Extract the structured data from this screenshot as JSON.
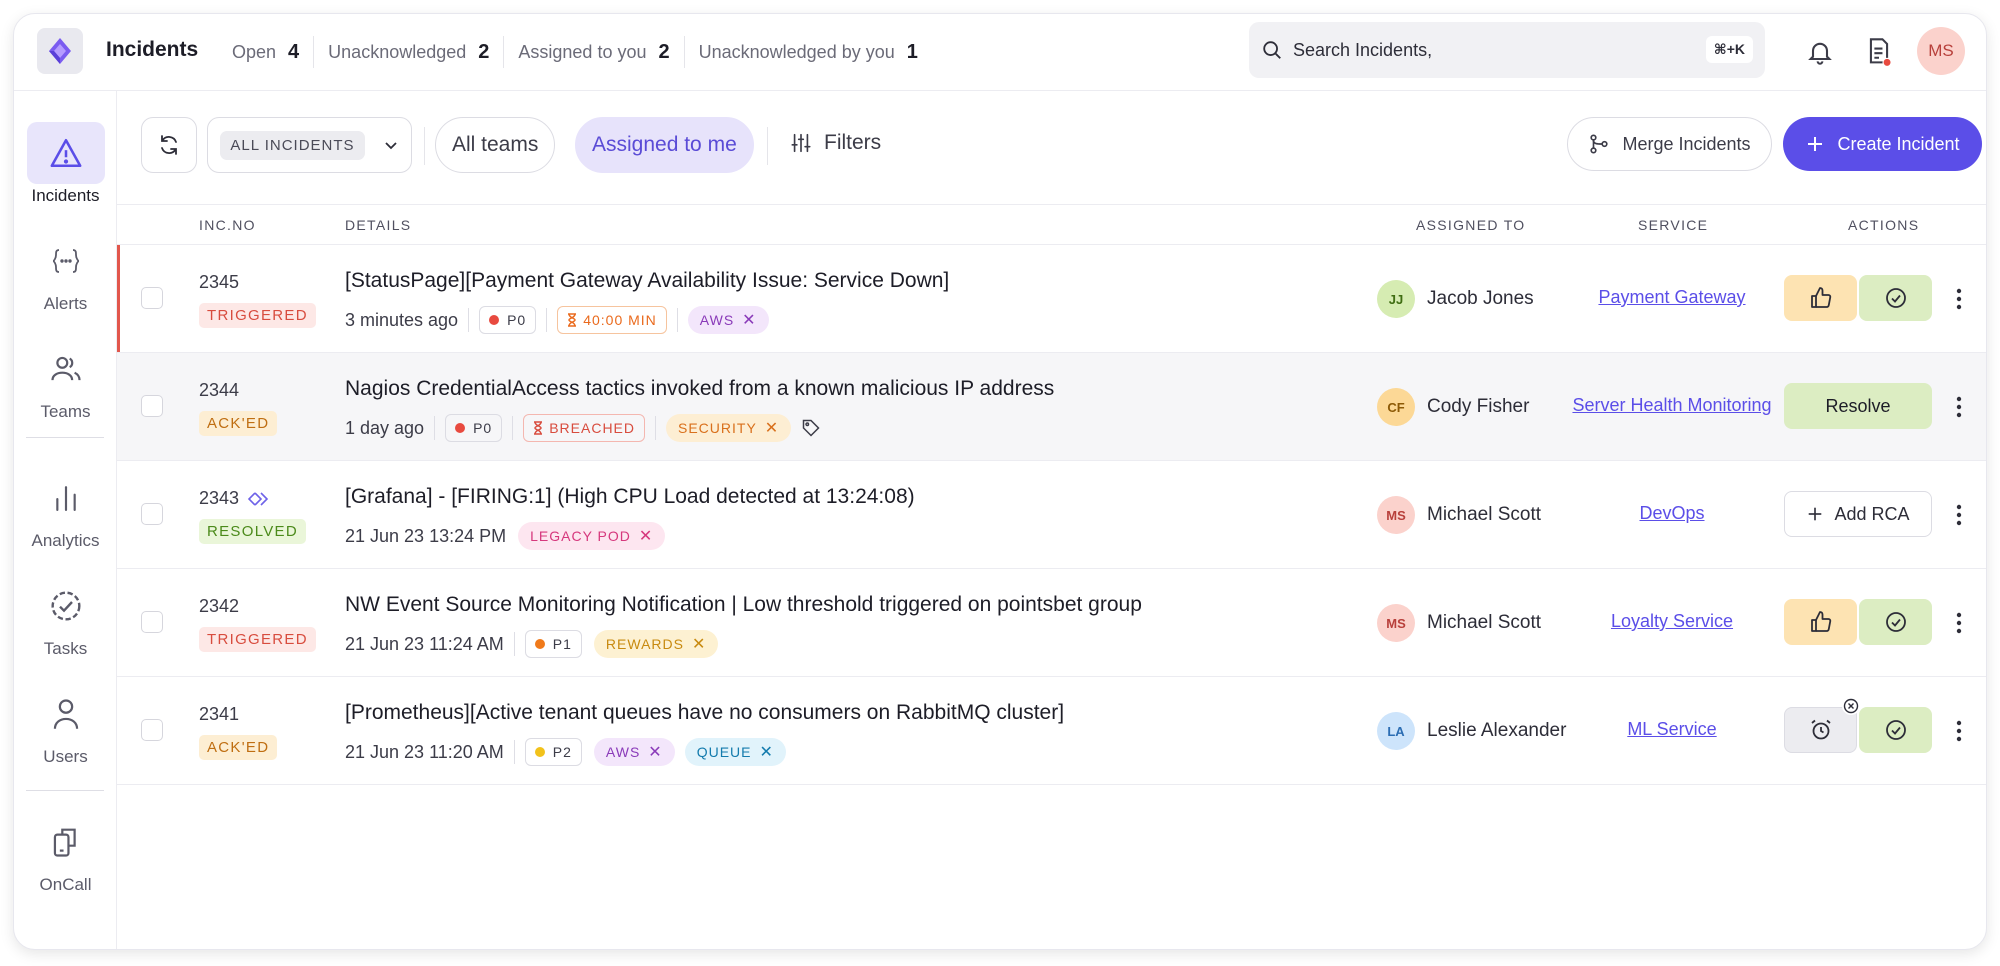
{
  "app": {
    "title": "Incidents"
  },
  "stats": [
    {
      "label": "Open",
      "count": "4"
    },
    {
      "label": "Unacknowledged",
      "count": "2"
    },
    {
      "label": "Assigned to you",
      "count": "2"
    },
    {
      "label": "Unacknowledged by you",
      "count": "1"
    }
  ],
  "search": {
    "placeholder": "Search Incidents,",
    "shortcut": "⌘+K"
  },
  "user": {
    "initials": "MS"
  },
  "sidebar": {
    "items": [
      {
        "label": "Incidents",
        "icon": "alert-triangle-icon",
        "active": true
      },
      {
        "label": "Alerts",
        "icon": "braces-icon"
      },
      {
        "label": "Teams",
        "icon": "users-icon"
      },
      {
        "label": "Analytics",
        "icon": "bar-chart-icon"
      },
      {
        "label": "Tasks",
        "icon": "check-circle-dashed-icon"
      },
      {
        "label": "Users",
        "icon": "user-icon"
      },
      {
        "label": "OnCall",
        "icon": "oncall-icon"
      }
    ]
  },
  "toolbar": {
    "select_value": "ALL INCIDENTS",
    "all_teams": "All teams",
    "assigned_to_me": "Assigned to me",
    "filters": "Filters",
    "merge": "Merge Incidents",
    "create": "Create Incident"
  },
  "table": {
    "headers": {
      "inc_no": "INC.NO",
      "details": "DETAILS",
      "assigned_to": "ASSIGNED TO",
      "service": "SERVICE",
      "actions": "ACTIONS"
    },
    "rows": [
      {
        "inc_no": "2345",
        "status": "TRIGGERED",
        "title": "[StatusPage][Payment Gateway Availability Issue: Service Down]",
        "time": "3 minutes ago",
        "priority": "P0",
        "priority_color": "#e84a3f",
        "sla": "40:00 MIN",
        "tags": [
          "AWS"
        ],
        "assignee": {
          "initials": "JJ",
          "name": "Jacob Jones"
        },
        "service": "Payment Gateway"
      },
      {
        "inc_no": "2344",
        "status": "ACK'ED",
        "title": "Nagios CredentialAccess tactics invoked from a known malicious IP address",
        "time": "1 day ago",
        "priority": "P0",
        "priority_color": "#e84a3f",
        "sla": "BREACHED",
        "tags": [
          "SECURITY"
        ],
        "assignee": {
          "initials": "CF",
          "name": "Cody Fisher"
        },
        "service": "Server Health Monitoring",
        "action": "Resolve"
      },
      {
        "inc_no": "2343",
        "status": "RESOLVED",
        "title": "[Grafana] - [FIRING:1] (High CPU Load detected at 13:24:08)",
        "time": "21 Jun 23 13:24 PM",
        "tags": [
          "LEGACY POD"
        ],
        "assignee": {
          "initials": "MS",
          "name": "Michael Scott"
        },
        "service": "DevOps",
        "action": "Add RCA"
      },
      {
        "inc_no": "2342",
        "status": "TRIGGERED",
        "title": "NW Event Source Monitoring Notification | Low threshold triggered on pointsbet group",
        "time": "21 Jun 23 11:24 AM",
        "priority": "P1",
        "priority_color": "#f07a1a",
        "tags": [
          "REWARDS"
        ],
        "assignee": {
          "initials": "MS",
          "name": "Michael Scott"
        },
        "service": "Loyalty Service"
      },
      {
        "inc_no": "2341",
        "status": "ACK'ED",
        "title": "[Prometheus][Active tenant queues have no consumers on RabbitMQ cluster]",
        "time": "21 Jun 23 11:20 AM",
        "priority": "P2",
        "priority_color": "#f2c21b",
        "tags": [
          "AWS",
          "QUEUE"
        ],
        "assignee": {
          "initials": "LA",
          "name": "Leslie Alexander"
        },
        "service": "ML Service"
      }
    ]
  },
  "colors": {
    "accent": "#5b4ee8",
    "triggered": "#d84c3e",
    "acked": "#bf6e12",
    "resolved": "#4b8a1a"
  }
}
